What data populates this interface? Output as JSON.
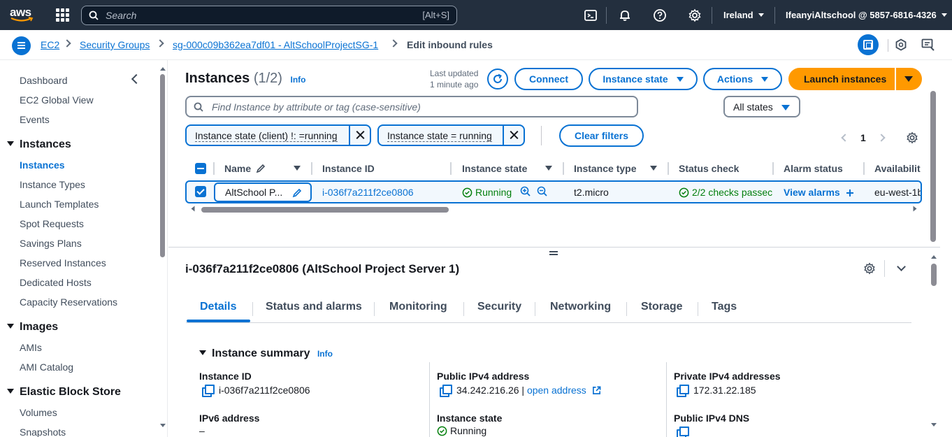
{
  "topnav": {
    "logo_text": "aws",
    "search_placeholder": "Search",
    "search_shortcut": "[Alt+S]",
    "region": "Ireland",
    "account": "IfeanyiAltschool @ 5857-6816-4326",
    "icons": [
      "cloudshell-icon",
      "bell-icon",
      "help-icon",
      "settings-icon"
    ]
  },
  "breadcrumb": {
    "items": [
      "EC2",
      "Security Groups",
      "sg-000c09b362ea7df01 - AltSchoolProjectSG-1",
      "Edit inbound rules"
    ]
  },
  "sidebar": {
    "top_items": [
      "Dashboard",
      "EC2 Global View",
      "Events"
    ],
    "instances_head": "Instances",
    "instances_items": [
      "Instances",
      "Instance Types",
      "Launch Templates",
      "Spot Requests",
      "Savings Plans",
      "Reserved Instances",
      "Dedicated Hosts",
      "Capacity Reservations"
    ],
    "images_head": "Images",
    "images_items": [
      "AMIs",
      "AMI Catalog"
    ],
    "ebs_head": "Elastic Block Store",
    "ebs_items": [
      "Volumes",
      "Snapshots"
    ]
  },
  "instances_panel": {
    "title": "Instances",
    "count": "(1/2)",
    "info": "Info",
    "last_updated_label": "Last updated",
    "last_updated_value": "1 minute ago",
    "connect": "Connect",
    "instance_state": "Instance state",
    "actions": "Actions",
    "launch": "Launch instances",
    "find_placeholder": "Find Instance by attribute or tag (case-sensitive)",
    "states_filter": "All states",
    "tokens": [
      "Instance state (client) !: =running",
      "Instance state = running"
    ],
    "clear_filters": "Clear filters",
    "page": "1"
  },
  "table": {
    "columns": [
      "Name",
      "Instance ID",
      "Instance state",
      "Instance type",
      "Status check",
      "Alarm status",
      "Availabilit"
    ],
    "row": {
      "name": "AltSchool P...",
      "instance_id": "i-036f7a211f2ce0806",
      "state": "Running",
      "type": "t2.micro",
      "status_check": "2/2 checks passec",
      "alarm": "View alarms",
      "az": "eu-west-1b"
    }
  },
  "details": {
    "title": "i-036f7a211f2ce0806 (AltSchool Project Server 1)",
    "tabs": [
      "Details",
      "Status and alarms",
      "Monitoring",
      "Security",
      "Networking",
      "Storage",
      "Tags"
    ],
    "summary_head": "Instance summary",
    "summary_info": "Info",
    "fields": {
      "instance_id_label": "Instance ID",
      "instance_id_value": "i-036f7a211f2ce0806",
      "public_ipv4_label": "Public IPv4 address",
      "public_ipv4_value": "34.242.216.26",
      "public_ipv4_sep": "|",
      "open_address": "open address",
      "private_ipv4_label": "Private IPv4 addresses",
      "private_ipv4_value": "172.31.22.185",
      "ipv6_label": "IPv6 address",
      "ipv6_value": "–",
      "instance_state_label": "Instance state",
      "instance_state_value": "Running",
      "public_dns_label": "Public IPv4 DNS"
    }
  },
  "colors": {
    "nav_bg": "#232f3e",
    "accent": "#0972d3",
    "launch": "#ff9900",
    "success": "#037f0c"
  }
}
